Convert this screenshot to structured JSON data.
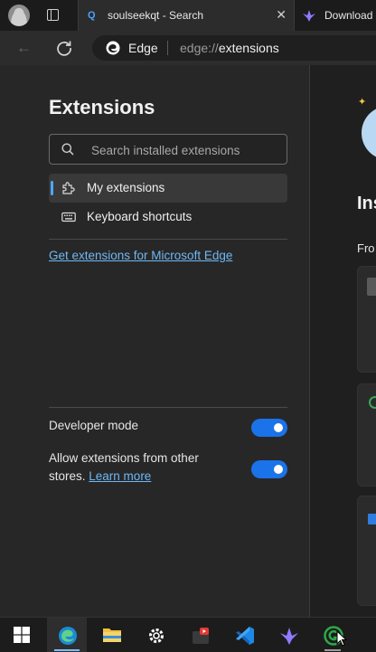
{
  "browser": {
    "tabs": [
      {
        "title": "soulseekqt - Search",
        "active": true
      },
      {
        "title": "Download",
        "active": false
      }
    ],
    "address": {
      "brand_label": "Edge",
      "url_scheme": "edge://",
      "url_host": "extensions"
    }
  },
  "sidebar": {
    "title": "Extensions",
    "search_placeholder": "Search installed extensions",
    "nav": [
      {
        "label": "My extensions",
        "selected": true,
        "icon": "puzzle-icon"
      },
      {
        "label": "Keyboard shortcuts",
        "selected": false,
        "icon": "keyboard-icon"
      }
    ],
    "get_extensions_link": "Get extensions for Microsoft Edge",
    "settings": {
      "developer_mode": {
        "label": "Developer mode",
        "enabled": true
      },
      "allow_other_stores": {
        "label": "Allow extensions from other stores.",
        "learn_more": "Learn more",
        "enabled": true
      }
    }
  },
  "main": {
    "heading_fragment": "Ins",
    "sub_fragment": "Fro"
  },
  "taskbar": {
    "apps": [
      "windows-start-icon",
      "edge-icon",
      "file-explorer-icon",
      "settings-gear-icon",
      "media-app-icon",
      "vscode-icon",
      "bird-app-icon",
      "green-app-icon"
    ]
  },
  "colors": {
    "accent": "#1a73e8",
    "link": "#6fb7f5",
    "panel": "#272727"
  }
}
